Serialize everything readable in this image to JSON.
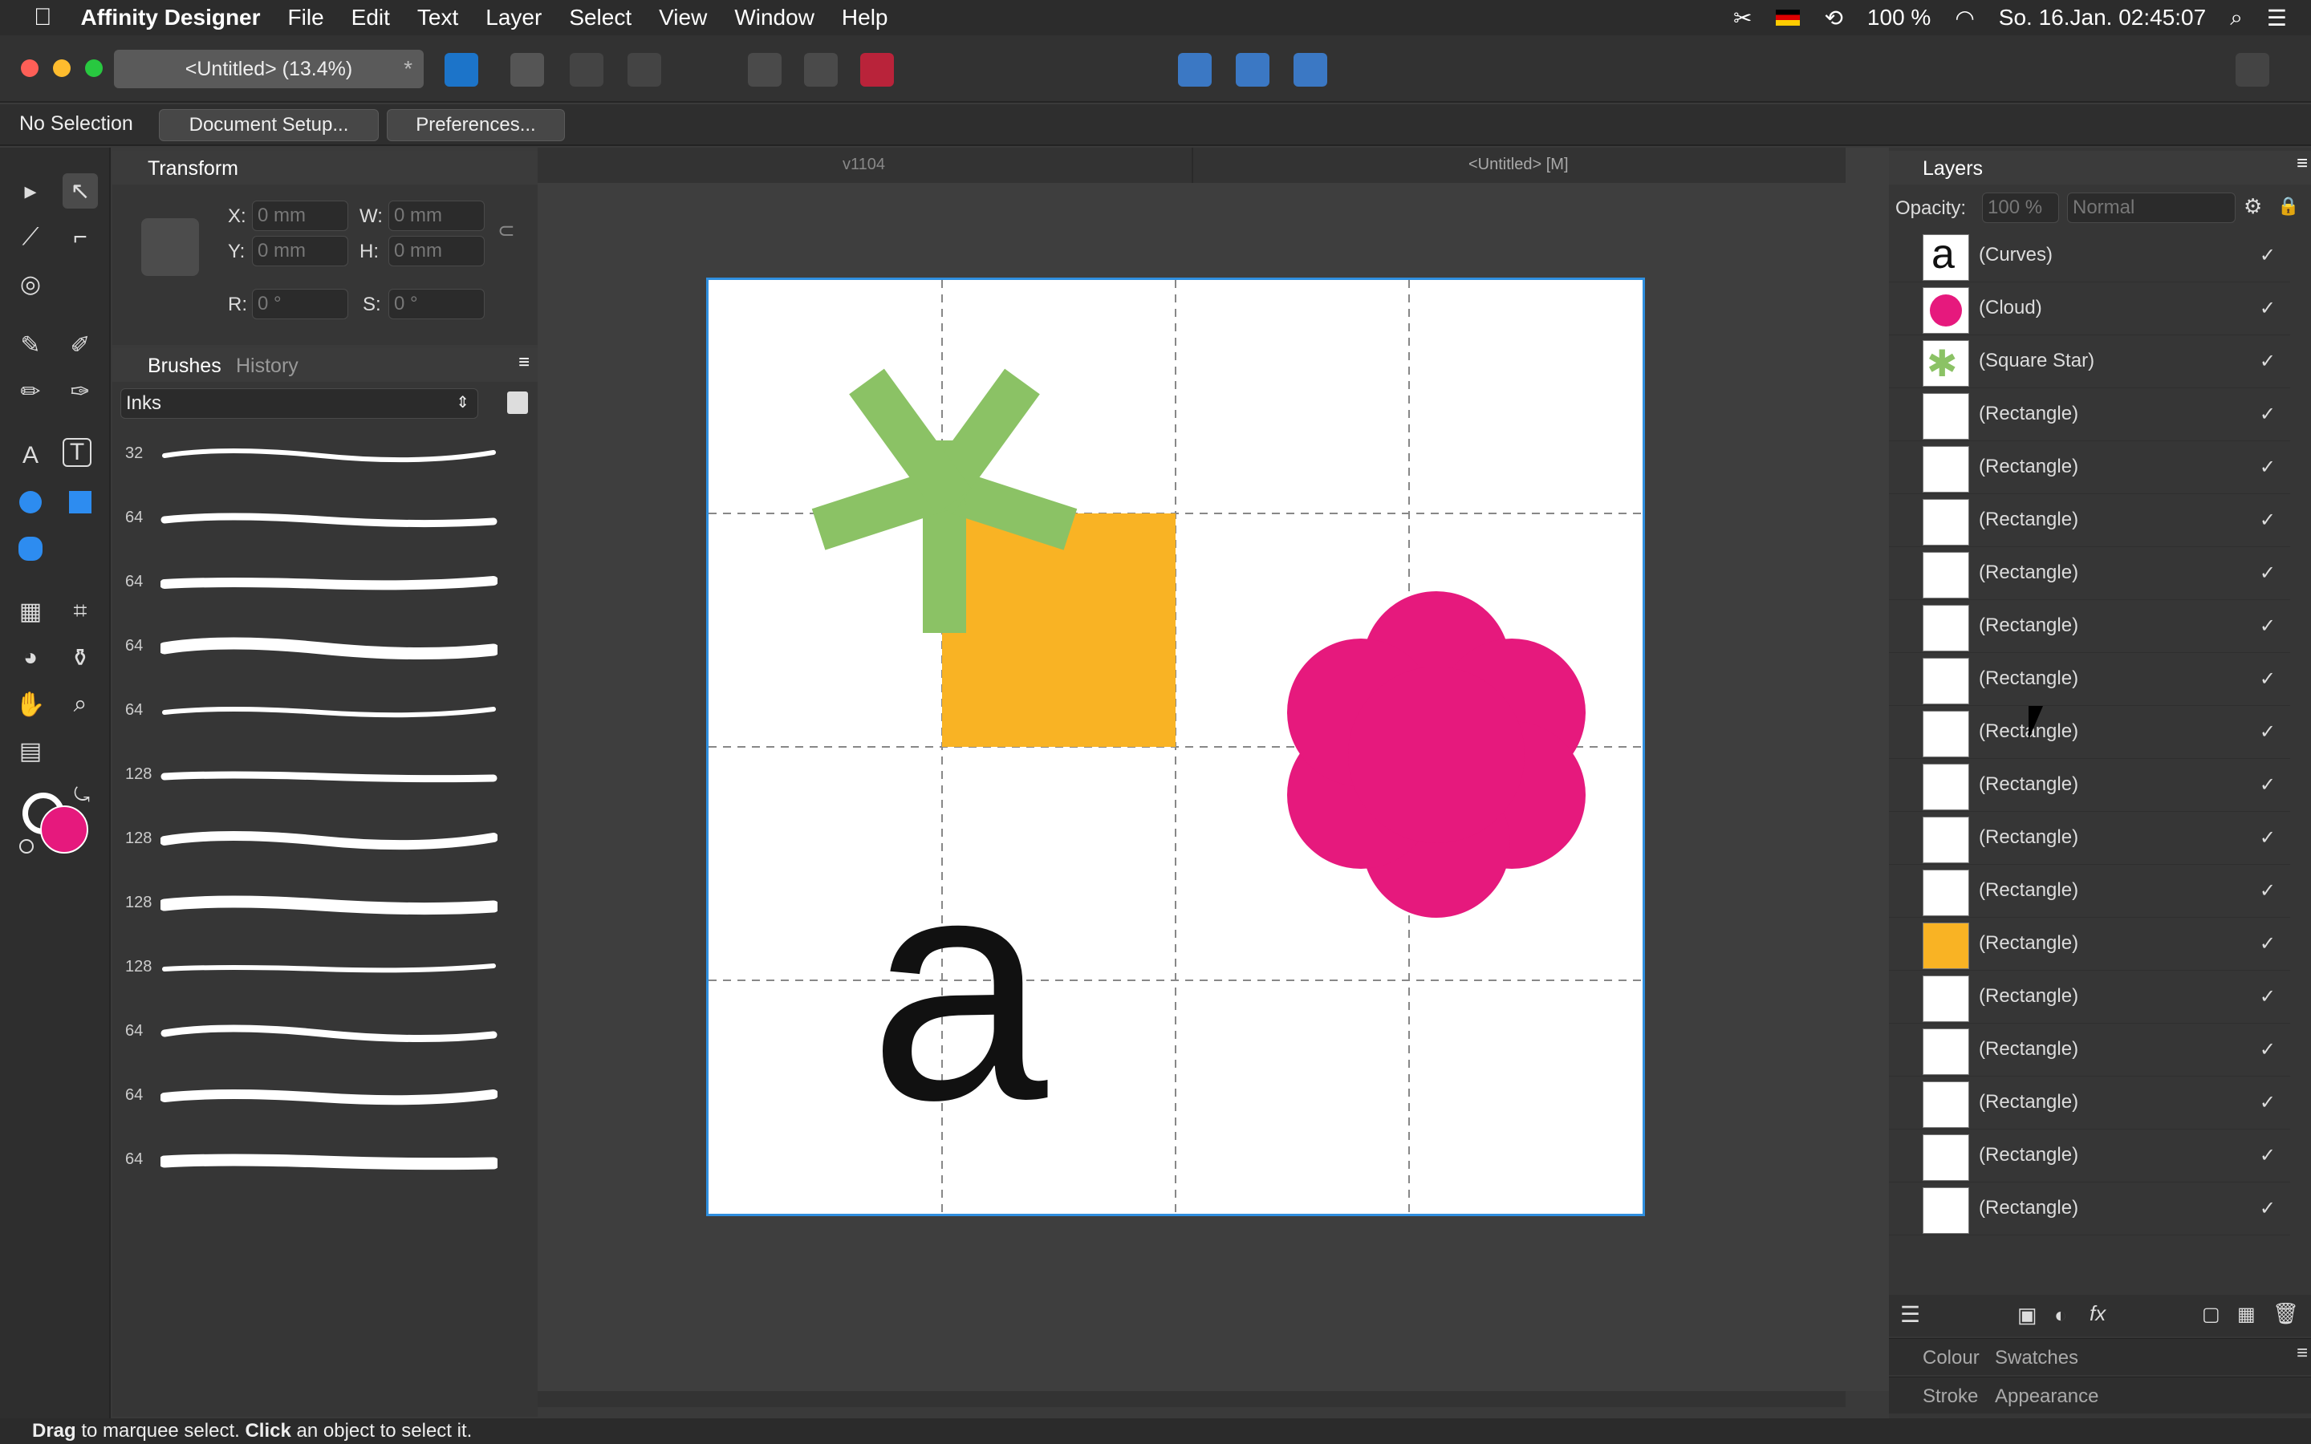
{
  "menubar": {
    "app_name": "Affinity Designer",
    "items": [
      "File",
      "Edit",
      "Text",
      "Layer",
      "Select",
      "View",
      "Window",
      "Help"
    ],
    "battery": "100 %",
    "datetime": "So. 16.Jan. 02:45:07"
  },
  "document": {
    "tab_title": "<Untitled> (13.4%)"
  },
  "contextbar": {
    "selection": "No Selection",
    "document_setup": "Document Setup...",
    "preferences": "Preferences..."
  },
  "transform": {
    "title": "Transform",
    "x_label": "X:",
    "x_value": "0 mm",
    "y_label": "Y:",
    "y_value": "0 mm",
    "w_label": "W:",
    "w_value": "0 mm",
    "h_label": "H:",
    "h_value": "0 mm",
    "r_label": "R:",
    "r_value": "0 °",
    "s_label": "S:",
    "s_value": "0 °"
  },
  "brushes": {
    "tab_brushes": "Brushes",
    "tab_history": "History",
    "category": "Inks",
    "sizes": [
      "32",
      "64",
      "64",
      "64",
      "64",
      "128",
      "128",
      "128",
      "128",
      "64",
      "64",
      "64"
    ]
  },
  "canvas": {
    "tab_left": "v1104",
    "tab_right": "<Untitled> [M]",
    "glyph": "a",
    "colors": {
      "orange": "#F9B324",
      "green": "#8BC265",
      "pink": "#E6197D"
    }
  },
  "layers": {
    "title": "Layers",
    "opacity_label": "Opacity:",
    "opacity_value": "100 %",
    "blend_mode": "Normal",
    "items": [
      {
        "name": "(Curves)",
        "thumb": "a"
      },
      {
        "name": "(Cloud)",
        "thumb": "cloud"
      },
      {
        "name": "(Square Star)",
        "thumb": "star"
      },
      {
        "name": "(Rectangle)",
        "thumb": "white"
      },
      {
        "name": "(Rectangle)",
        "thumb": "white"
      },
      {
        "name": "(Rectangle)",
        "thumb": "white"
      },
      {
        "name": "(Rectangle)",
        "thumb": "white"
      },
      {
        "name": "(Rectangle)",
        "thumb": "white"
      },
      {
        "name": "(Rectangle)",
        "thumb": "white"
      },
      {
        "name": "(Rectangle)",
        "thumb": "white"
      },
      {
        "name": "(Rectangle)",
        "thumb": "white"
      },
      {
        "name": "(Rectangle)",
        "thumb": "white"
      },
      {
        "name": "(Rectangle)",
        "thumb": "white"
      },
      {
        "name": "(Rectangle)",
        "thumb": "orange"
      },
      {
        "name": "(Rectangle)",
        "thumb": "white"
      },
      {
        "name": "(Rectangle)",
        "thumb": "white"
      },
      {
        "name": "(Rectangle)",
        "thumb": "white"
      },
      {
        "name": "(Rectangle)",
        "thumb": "white"
      },
      {
        "name": "(Rectangle)",
        "thumb": "white"
      }
    ],
    "check": "✓"
  },
  "bottom_panels": {
    "colour": "Colour",
    "swatches": "Swatches",
    "stroke": "Stroke",
    "appearance": "Appearance"
  },
  "status": {
    "drag": "Drag",
    "text1": " to marquee select. ",
    "click": "Click",
    "text2": " an object to select it."
  }
}
